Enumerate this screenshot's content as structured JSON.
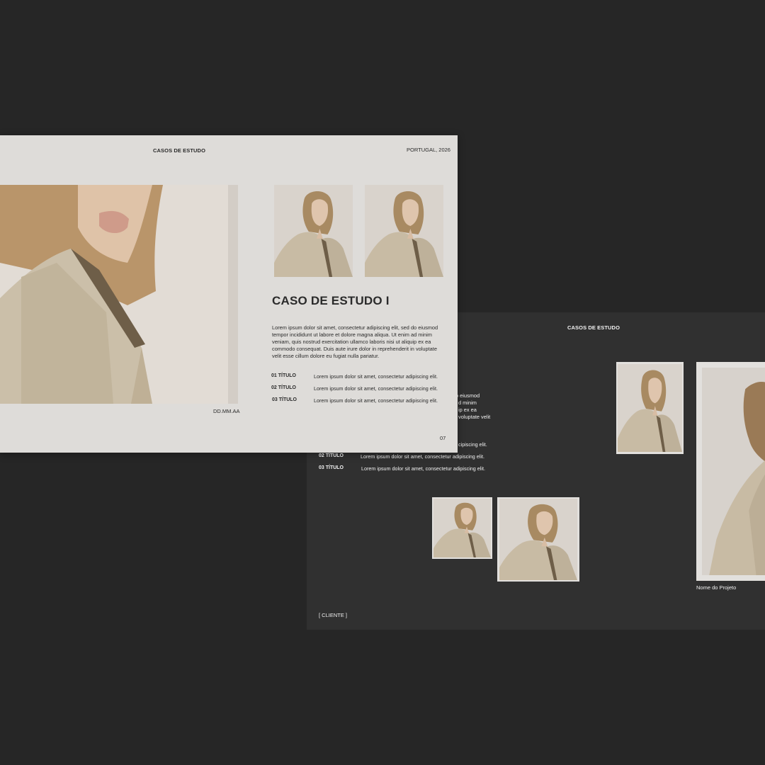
{
  "back_slide": {
    "header": "CASOS DE ESTUDO",
    "peek_lines": [
      "o eiusmod",
      "d minim",
      "ip ex ea",
      "voluptate velit"
    ],
    "items": [
      {
        "label": "",
        "text": "cipiscing elit."
      },
      {
        "label": "02 TÍTULO",
        "text": "Lorem ipsum dolor sit amet, consectetur adipiscing elit."
      },
      {
        "label": "03 TÍTULO",
        "text": "Lorem ipsum dolor sit amet, consectetur adipiscing elit."
      }
    ],
    "caption": "Nome do Projeto",
    "client": "[ CLIENTE ]"
  },
  "front_slide": {
    "header": "CASOS DE ESTUDO",
    "location": "PORTUGAL, 2026",
    "title": "CASO DE ESTUDO I",
    "paragraph": "Lorem ipsum dolor sit amet, consectetur adipiscing elit, sed do eiusmod tempor incididunt ut labore et dolore magna aliqua. Ut enim ad minim veniam, quis nostrud exercitation ullamco laboris nisi ut aliquip ex ea commodo consequat. Duis aute irure dolor in reprehenderit in voluptate velit esse cillum dolore eu fugiat nulla pariatur.",
    "items": [
      {
        "label": "01 TÍTULO",
        "text": "Lorem ipsum dolor sit amet, consectetur adipiscing elit."
      },
      {
        "label": "02 TÍTULO",
        "text": "Lorem ipsum dolor sit amet, consectetur adipiscing elit."
      },
      {
        "label": "03 TÍTULO",
        "text": "Lorem ipsum dolor sit amet, consectetur adipiscing elit."
      }
    ],
    "date": "DD.MM.AA",
    "page_number": "07"
  },
  "colors": {
    "background": "#262626",
    "dark_slide": "#303030",
    "light_slide": "#dedcd9",
    "coat": "#c8bba4",
    "hair": "#a88a62"
  },
  "images": {
    "subject": "portrait of woman with blonde hair in beige coat"
  }
}
